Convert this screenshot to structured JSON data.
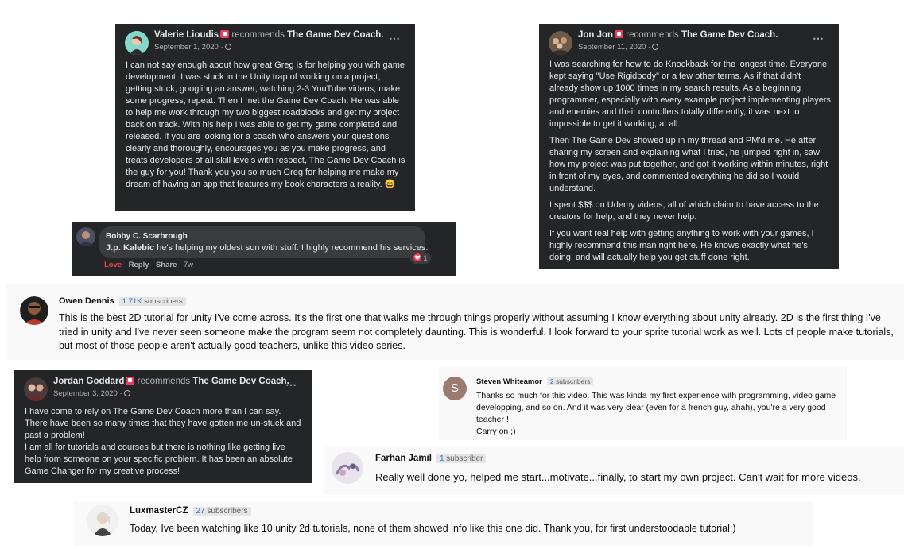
{
  "page_name": "The Game Dev Coach",
  "recommends_label": "recommends",
  "valerie": {
    "name": "Valerie Lioudis",
    "date": "September 1, 2020 ·",
    "text": "I can not say enough about how great Greg is for helping you with game development. I was stuck in the Unity trap of working on a project, getting stuck, googling an answer, watching 2-3 YouTube videos, make some progress, repeat. Then I met the Game Dev Coach. He was able to help me work through my two biggest roadblocks and get my project back on track. With his help I was able to get my game completed and released. If you are looking for a coach who answers your questions clearly and thoroughly, encourages you as you make progress, and treats developers of all skill levels with respect, The Game Dev Coach is the guy for you! Thank you you so much Greg for helping me make my dream of having an app that features my book characters a reality. 😄"
  },
  "bobby": {
    "name": "Bobby C. Scarbrough",
    "mention": "J.p. Kalebic",
    "text": "he's helping my oldest son with stuff. I highly recommend his services.",
    "love": "Love",
    "reply": "Reply",
    "share": "Share",
    "time": "7w",
    "reaction_count": "1"
  },
  "jon": {
    "name": "Jon Jon",
    "date": "September 11, 2020 ·",
    "paragraphs": [
      "I was searching for how to do Knockback for the longest time. Everyone kept saying \"Use Rigidbody\" or a few other terms. As if that didn't already show up 1000 times in my search results. As a beginning programmer, especially with every example project implementing players and enemies and their controllers totally differently, it was next to impossible to get it working, at all.",
      "Then The Game Dev showed up in my thread and PM'd me. He after sharing my screen and explaining what I tried, he jumped right in, saw how my project was put together, and got it working within minutes, right in front of my eyes, and commented everything he did so I would understand.",
      "I spent $$$ on Udemy videos, all of which claim to have access to the creators for help, and they never help.",
      "If you want real help with getting anything to work with your games, I highly recommend this man right here. He knows exactly what he's doing, and will actually help you get stuff done right."
    ]
  },
  "owen": {
    "name": "Owen Dennis",
    "subs_num": "1.71K",
    "subs_label": "subscribers",
    "text": "This is the best 2D tutorial for unity I've come across. It's the first one that walks me through things properly without assuming I know everything about unity already. 2D is the first thing I've tried in unity and I've never seen someone make the program seem not completely daunting. This is wonderful. I look forward to your sprite tutorial work as well. Lots of people make tutorials, but most of those people aren't actually good teachers, unlike this video series."
  },
  "jordan": {
    "name": "Jordan Goddard",
    "date": "September 3, 2020 ·",
    "paragraphs": [
      "I have come to rely on The Game Dev Coach more than I can say. There have been so many times that they have gotten me un-stuck and past a problem!",
      "I am all for tutorials and courses but there is nothing like getting live help from someone on your specific problem. It has been an absolute Game Changer for my creative process!"
    ]
  },
  "steven": {
    "name": "Steven Whiteamor",
    "subs_num": "2",
    "subs_label": "subscribers",
    "avatar_letter": "S",
    "lines": [
      "Thanks so much for this video. This was kinda my first experience with programming, video game developping, and so on. And it was very clear (even for a french guy, ahah), you're a very good teacher !",
      "Carry on ;)"
    ]
  },
  "farhan": {
    "name": "Farhan Jamil",
    "subs_num": "1",
    "subs_label": "subscriber",
    "text": "Really well done yo, helped me start...motivate...finally, to start my own project. Can't wait for more videos."
  },
  "lux": {
    "name": "LuxmasterCZ",
    "subs_num": "27",
    "subs_label": "subscribers",
    "text": "Today, Ive been watching like 10 unity 2d tutorials, none of them showed info like this one did. Thank you, for first understoodable tutorial;)"
  },
  "more_icon": "⋯",
  "colors": {
    "fb_card": "#242526",
    "yt_card": "#f9f9f9",
    "love": "#f33e58",
    "sub_count": "#2a6fc4"
  }
}
